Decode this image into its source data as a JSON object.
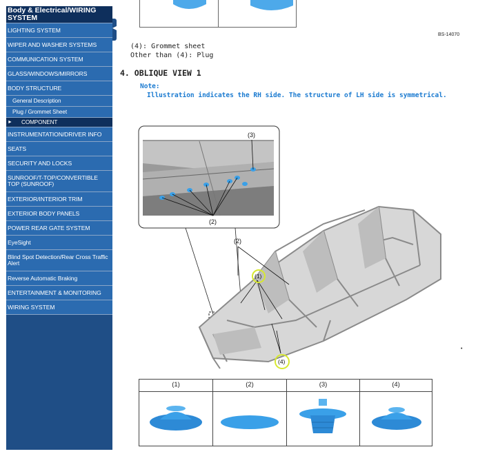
{
  "sidebar": {
    "header": "Body & Electrical/WIRING SYSTEM",
    "items": [
      {
        "label": "LIGHTING SYSTEM"
      },
      {
        "label": "WIPER AND WASHER SYSTEMS"
      },
      {
        "label": "COMMUNICATION SYSTEM"
      },
      {
        "label": "GLASS/WINDOWS/MIRRORS"
      },
      {
        "label": "BODY STRUCTURE"
      }
    ],
    "sub_items": [
      {
        "label": "General Description"
      },
      {
        "label": "Plug / Grommet Sheet"
      }
    ],
    "current": {
      "label": "COMPONENT"
    },
    "items_after": [
      {
        "label": "INSTRUMENTATION/DRIVER INFO"
      },
      {
        "label": "SEATS"
      },
      {
        "label": "SECURITY AND LOCKS"
      },
      {
        "label": "SUNROOF/T-TOP/CONVERTIBLE TOP (SUNROOF)"
      },
      {
        "label": "EXTERIOR/INTERIOR TRIM"
      },
      {
        "label": "EXTERIOR BODY PANELS"
      },
      {
        "label": "POWER REAR GATE SYSTEM"
      },
      {
        "label": "EyeSight"
      },
      {
        "label": "Blind Spot Detection/Rear Cross Traffic Alert"
      },
      {
        "label": "Reverse Automatic Braking"
      },
      {
        "label": "ENTERTAINMENT & MONITORING"
      },
      {
        "label": "WIRING SYSTEM"
      }
    ]
  },
  "content": {
    "figure_code": "BS-14070",
    "desc_line1": "(4): Grommet sheet",
    "desc_line2": "Other than (4): Plug",
    "section_title": "4. OBLIQUE VIEW 1",
    "note_label": "Note:",
    "note_text": "Illustration indicates the RH side. The structure of LH side is symmetrical.",
    "callouts": {
      "c1": "(1)",
      "c2_inset": "(2)",
      "c2_main": "(2)",
      "c3": "(3)",
      "c4": "(4)"
    },
    "parts_table": {
      "columns": [
        "(1)",
        "(2)",
        "(3)",
        "(4)"
      ]
    }
  },
  "colors": {
    "sidebar_dark": "#0e2f5c",
    "sidebar_item": "#2b6bb0",
    "note_blue": "#1a7ad0",
    "part_blue": "#3aa0e8",
    "highlight_circle": "#d7e830"
  },
  "icons": {
    "collapse": "chevron-left-icon",
    "current_item": "triangle-right-icon"
  }
}
